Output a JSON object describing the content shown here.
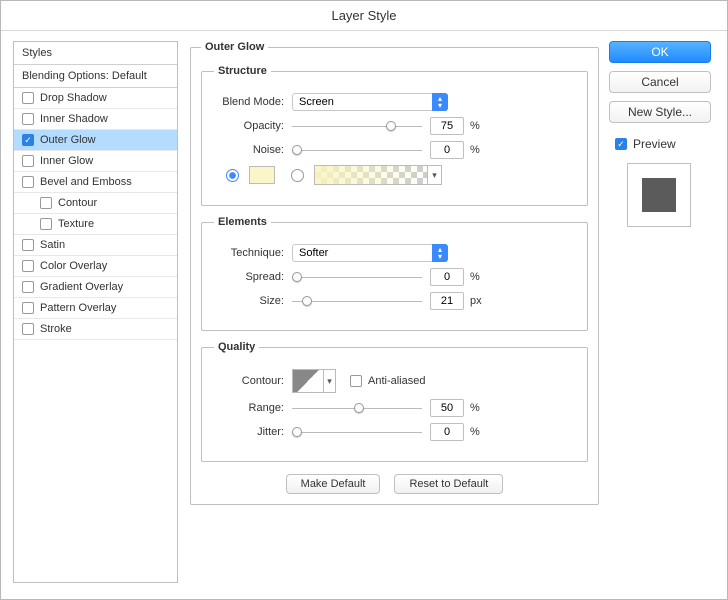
{
  "title": "Layer Style",
  "sidebar": {
    "header": "Styles",
    "blending": "Blending Options: Default",
    "items": [
      {
        "label": "Drop Shadow",
        "checked": false
      },
      {
        "label": "Inner Shadow",
        "checked": false
      },
      {
        "label": "Outer Glow",
        "checked": true,
        "selected": true
      },
      {
        "label": "Inner Glow",
        "checked": false
      },
      {
        "label": "Bevel and Emboss",
        "checked": false
      },
      {
        "label": "Contour",
        "checked": false,
        "indent": true
      },
      {
        "label": "Texture",
        "checked": false,
        "indent": true
      },
      {
        "label": "Satin",
        "checked": false
      },
      {
        "label": "Color Overlay",
        "checked": false
      },
      {
        "label": "Gradient Overlay",
        "checked": false
      },
      {
        "label": "Pattern Overlay",
        "checked": false
      },
      {
        "label": "Stroke",
        "checked": false
      }
    ]
  },
  "main": {
    "group_title": "Outer Glow",
    "structure": {
      "legend": "Structure",
      "blend_mode_label": "Blend Mode:",
      "blend_mode_value": "Screen",
      "opacity_label": "Opacity:",
      "opacity_value": "75",
      "opacity_unit": "%",
      "noise_label": "Noise:",
      "noise_value": "0",
      "noise_unit": "%",
      "color_radio": "color",
      "swatch_color": "#fbf6c9"
    },
    "elements": {
      "legend": "Elements",
      "technique_label": "Technique:",
      "technique_value": "Softer",
      "spread_label": "Spread:",
      "spread_value": "0",
      "spread_unit": "%",
      "size_label": "Size:",
      "size_value": "21",
      "size_unit": "px"
    },
    "quality": {
      "legend": "Quality",
      "contour_label": "Contour:",
      "antialiased_label": "Anti-aliased",
      "range_label": "Range:",
      "range_value": "50",
      "range_unit": "%",
      "jitter_label": "Jitter:",
      "jitter_value": "0",
      "jitter_unit": "%"
    },
    "buttons": {
      "make_default": "Make Default",
      "reset_default": "Reset to Default"
    }
  },
  "right": {
    "ok": "OK",
    "cancel": "Cancel",
    "new_style": "New Style...",
    "preview_label": "Preview"
  }
}
